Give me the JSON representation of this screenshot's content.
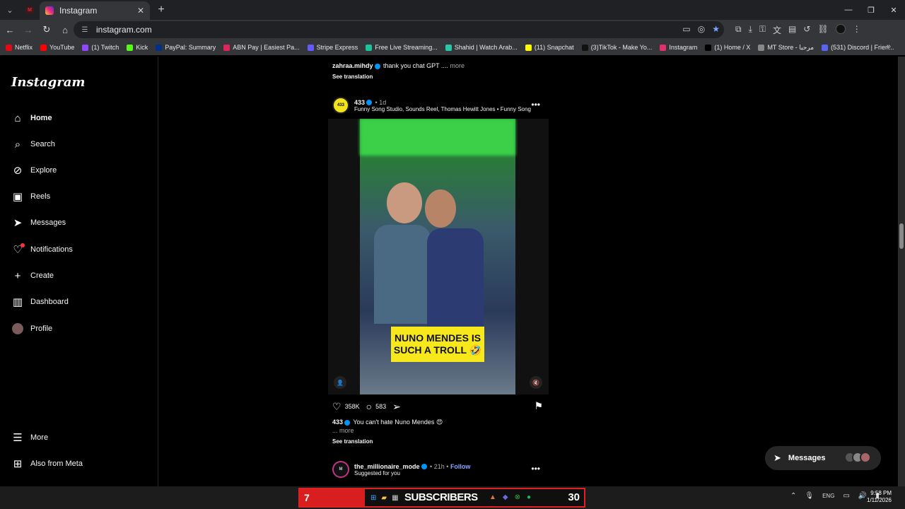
{
  "browser": {
    "tab_title": "Instagram",
    "url": "instagram.com",
    "bookmarks": [
      {
        "label": "Netflix",
        "color": "#e50914"
      },
      {
        "label": "YouTube",
        "color": "#ff0000"
      },
      {
        "label": "(1) Twitch",
        "color": "#9146ff"
      },
      {
        "label": "Kick",
        "color": "#53fc18"
      },
      {
        "label": "PayPal: Summary",
        "color": "#003087"
      },
      {
        "label": "ABN Pay | Easiest Pa...",
        "color": "#e0245e"
      },
      {
        "label": "Stripe Express",
        "color": "#635bff"
      },
      {
        "label": "Free Live Streaming...",
        "color": "#19c39c"
      },
      {
        "label": "Shahid | Watch Arab...",
        "color": "#28c7a5"
      },
      {
        "label": "(11) Snapchat",
        "color": "#fffc00"
      },
      {
        "label": "(3)TikTok - Make Yo...",
        "color": "#111111"
      },
      {
        "label": "Instagram",
        "color": "#e1306c"
      },
      {
        "label": "(1) Home / X",
        "color": "#000000"
      },
      {
        "label": "MT Store - مرحبا",
        "color": "#888888"
      },
      {
        "label": "(531) Discord | Frien...",
        "color": "#5865f2"
      }
    ]
  },
  "sidebar": {
    "logo": "Instagram",
    "items": [
      {
        "label": "Home",
        "icon": "home-icon",
        "glyph": "⌂"
      },
      {
        "label": "Search",
        "icon": "search-icon",
        "glyph": "⌕"
      },
      {
        "label": "Explore",
        "icon": "explore-icon",
        "glyph": "⊘"
      },
      {
        "label": "Reels",
        "icon": "reels-icon",
        "glyph": "▣"
      },
      {
        "label": "Messages",
        "icon": "messages-icon",
        "glyph": "➤"
      },
      {
        "label": "Notifications",
        "icon": "heart-icon",
        "glyph": "♡"
      },
      {
        "label": "Create",
        "icon": "plus-icon",
        "glyph": "+"
      },
      {
        "label": "Dashboard",
        "icon": "dashboard-icon",
        "glyph": "▥"
      },
      {
        "label": "Profile",
        "icon": "profile-avatar-icon",
        "glyph": ""
      }
    ],
    "more": "More",
    "also_from_meta": "Also from Meta"
  },
  "feed": {
    "prev_post": {
      "username": "zahraa.mihdy",
      "caption": "thank you chat GPT ....",
      "more": "more",
      "see_translation": "See translation"
    },
    "post": {
      "username": "433",
      "avatar_text": "433",
      "age": "1d",
      "audio": "Funny Song Studio, Sounds Reel, Thomas Hewitt Jones • Funny Song",
      "overlay_line1": "NUNO MENDES IS",
      "overlay_line2": "SUCH A TROLL 🤣",
      "likes": "358K",
      "comments": "583",
      "caption_user": "433",
      "caption": "You can't hate Nuno Mendes 😍",
      "more": "... more",
      "see_translation": "See translation"
    },
    "next_post": {
      "username": "the_millionaire_mode",
      "age": "21h",
      "follow": "Follow",
      "suggested": "Suggested for you"
    }
  },
  "messages_pill": {
    "label": "Messages"
  },
  "taskbar": {
    "overlay_left": "7",
    "overlay_text": "SUBSCRIBERS",
    "overlay_right": "30",
    "lang": "ENG",
    "time": "9:58 PM",
    "date": "1/11/2026"
  }
}
